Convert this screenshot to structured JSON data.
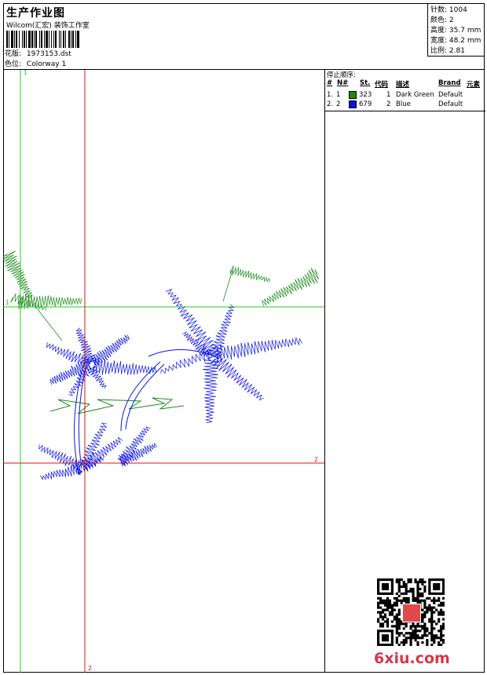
{
  "header": {
    "title": "生产作业图",
    "company": "Wilcom(汇宏) 装饰工作室",
    "design_label": "花版:",
    "design_value": "1973153.dst",
    "colorway_label": "色位:",
    "colorway_value": "Colorway 1"
  },
  "stats": {
    "stitches_label": "针数:",
    "stitches_value": "1004",
    "colors_label": "颜色:",
    "colors_value": "2",
    "height_label": "高度:",
    "height_value": "35.7 mm",
    "width_label": "宽度:",
    "width_value": "48.2 mm",
    "scale_label": "比例:",
    "scale_value": "2.81"
  },
  "stop_sequence": {
    "heading": "停止顺序:",
    "columns": [
      "#",
      "N#",
      "St.",
      "代码",
      "描述",
      "Brand",
      "元素"
    ],
    "rows": [
      {
        "idx": "1.",
        "needle": "1",
        "color": "#1e8a1e",
        "stitches": "323",
        "code": "1",
        "desc": "Dark Green",
        "brand": "Default"
      },
      {
        "idx": "2.",
        "needle": "2",
        "color": "#0a14e6",
        "stitches": "679",
        "code": "2",
        "desc": "Blue",
        "brand": "Default"
      }
    ]
  },
  "guides": {
    "green_vertical_label": "1",
    "green_horizontal_label": "1",
    "red_horizontal_label": "2",
    "red_vertical_label": "2",
    "green_color": "#22cc22",
    "red_color": "#e01010"
  },
  "watermark": {
    "site": "6xiu.com",
    "seal_text": "汉码 图章"
  }
}
